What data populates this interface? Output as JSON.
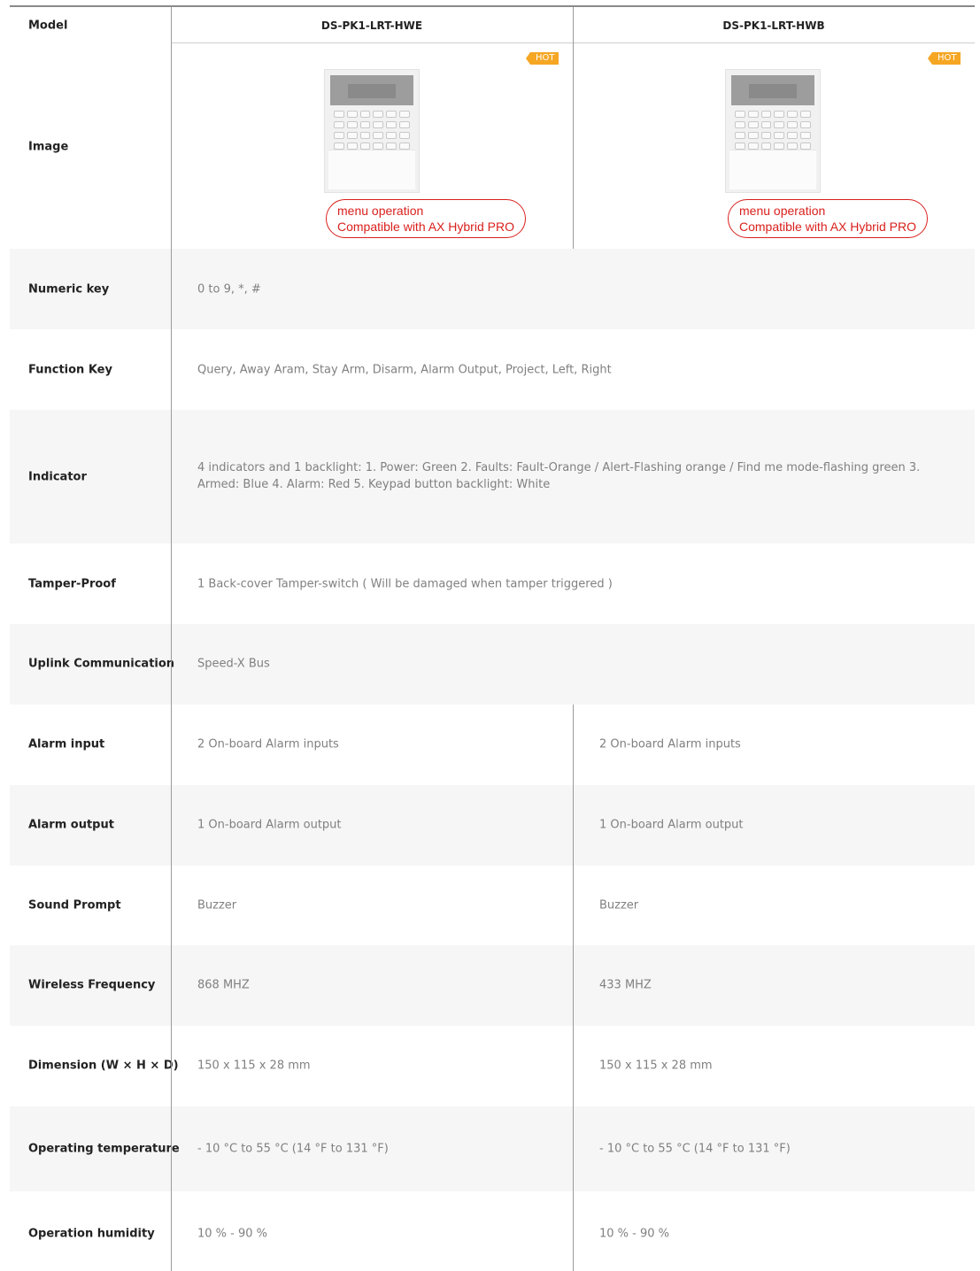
{
  "header": {
    "label": "Model",
    "models": [
      "DS-PK1-LRT-HWE",
      "DS-PK1-LRT-HWB"
    ]
  },
  "image_row": {
    "label": "Image",
    "badge": "HOT",
    "note_line1": "menu operation",
    "note_line2": "Compatible with AX Hybrid PRO"
  },
  "rows": [
    {
      "label": "Numeric key",
      "value": "0 to 9, *, #"
    },
    {
      "label": "Function Key",
      "value": "Query, Away Aram, Stay Arm, Disarm, Alarm Output, Project, Left, Right"
    },
    {
      "label": "Indicator",
      "value": "4 indicators and 1 backlight:  1. Power: Green 2. Faults: Fault-Orange / Alert-Flashing orange / Find me mode-flashing green 3. Armed: Blue 4. Alarm: Red 5. Keypad button backlight: White"
    },
    {
      "label": "Tamper-Proof",
      "value": "1 Back-cover Tamper-switch ( Will be damaged when tamper triggered )"
    },
    {
      "label": "Uplink Communication",
      "value": "Speed-X Bus"
    },
    {
      "label": "Alarm input",
      "values": [
        "2 On-board Alarm inputs",
        "2 On-board Alarm inputs"
      ]
    },
    {
      "label": "Alarm output",
      "values": [
        "1 On-board Alarm output",
        "1 On-board Alarm output"
      ]
    },
    {
      "label": "Sound Prompt",
      "values": [
        "Buzzer",
        "Buzzer"
      ]
    },
    {
      "label": "Wireless Frequency",
      "values": [
        "868 MHZ",
        "433 MHZ"
      ]
    },
    {
      "label": "Dimension (W × H × D)",
      "values": [
        "150 x 115 x 28 mm",
        "150 x 115 x 28 mm"
      ]
    },
    {
      "label": "Operating temperature",
      "values": [
        "- 10 °C to 55 °C (14 °F to 131 °F)",
        "- 10 °C to 55 °C (14 °F to 131 °F)"
      ]
    },
    {
      "label": "Operation humidity",
      "values": [
        "10 % - 90 %",
        "10 % - 90 %"
      ]
    }
  ],
  "colors": {
    "badge": "#f5a623",
    "note": "#d9201d",
    "row_alt": "#f6f6f6"
  }
}
